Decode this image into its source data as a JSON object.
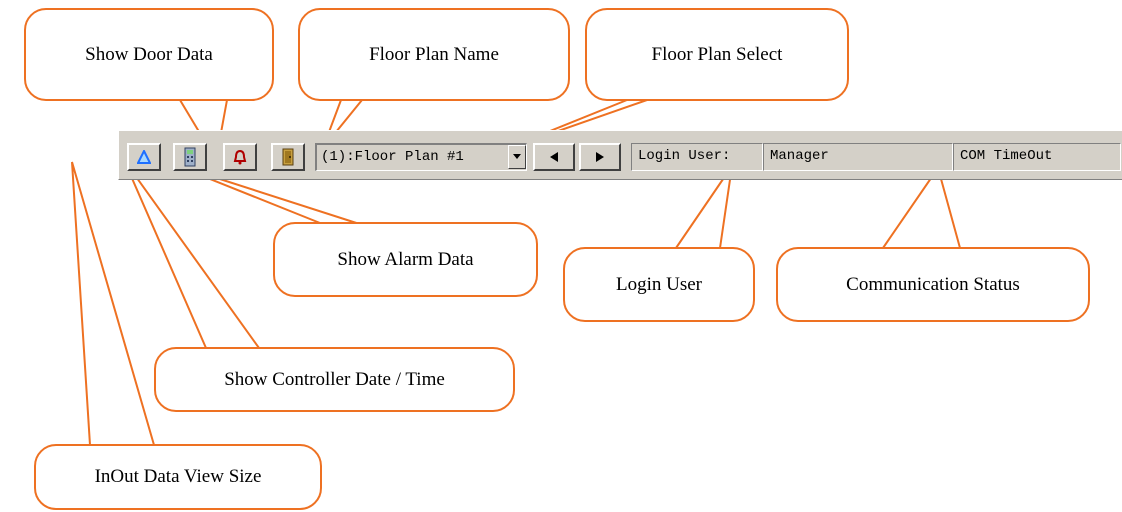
{
  "toolbar": {
    "floor_plan_select": "(1):Floor Plan #1",
    "login_label": "Login User:",
    "login_user": "Manager",
    "com_status": "COM TimeOut"
  },
  "callouts": {
    "show_door_data": "Show Door Data",
    "floor_plan_name": "Floor Plan Name",
    "floor_plan_select": "Floor Plan Select",
    "show_alarm_data": "Show Alarm Data",
    "login_user": "Login User",
    "communication_status": "Communication Status",
    "show_controller_date_time": "Show Controller Date / Time",
    "inout_data_view_size": "InOut Data View Size"
  },
  "icons": {
    "inout_view": "triangle-icon",
    "controller_datetime": "phone-device-icon",
    "alarm": "bell-icon",
    "door": "door-icon",
    "prev": "arrow-left-icon",
    "next": "arrow-right-icon",
    "dropdown": "chevron-down-icon"
  },
  "colors": {
    "callout_border": "#ee7122",
    "toolbar_bg": "#d4d0c8",
    "triangle_icon": "#1e6fff",
    "bell_icon": "#b00000"
  }
}
